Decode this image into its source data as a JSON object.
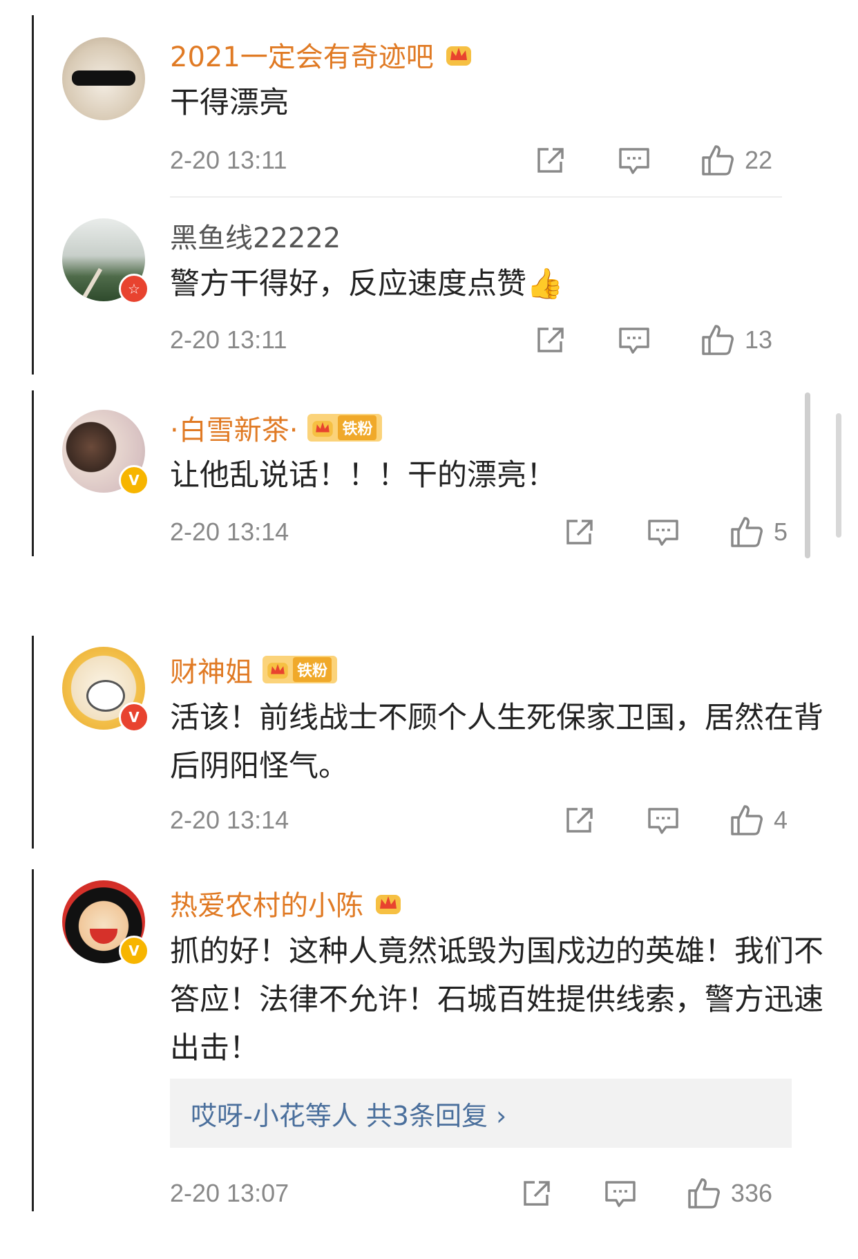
{
  "comments": [
    {
      "username": "2021一定会有奇迹吧",
      "text": "干得漂亮",
      "time": "2-20 13:11",
      "likes": "22",
      "name_color": "orange",
      "verified": "none",
      "crown": true,
      "fan_badge": null
    },
    {
      "username": "黑鱼线22222",
      "text": "警方干得好，反应速度点赞👍",
      "time": "2-20 13:11",
      "likes": "13",
      "name_color": "gray",
      "verified": "red-star",
      "crown": false,
      "fan_badge": null
    },
    {
      "username": "·白雪新茶·",
      "text": "让他乱说话！！！干的漂亮！",
      "time": "2-20 13:14",
      "likes": "5",
      "name_color": "orange",
      "verified": "gold-v",
      "crown": true,
      "fan_badge": "铁粉"
    },
    {
      "username": "财神姐",
      "text": "活该！前线战士不顾个人生死保家卫国，居然在背后阴阳怪气。",
      "time": "2-20 13:14",
      "likes": "4",
      "name_color": "orange",
      "verified": "red-v",
      "crown": true,
      "fan_badge": "铁粉"
    },
    {
      "username": "热爱农村的小陈",
      "text": "抓的好！这种人竟然诋毁为国戍边的英雄！我们不答应！法律不允许！石城百姓提供线索，警方迅速出击！",
      "time": "2-20 13:07",
      "likes": "336",
      "name_color": "orange",
      "verified": "gold-v",
      "crown": true,
      "fan_badge": null,
      "replies_summary": "哎呀-小花等人  共3条回复 ›"
    }
  ],
  "colors": {
    "orange_name": "#e07a24",
    "reply_link": "#4a6f9c",
    "meta_gray": "#888888"
  },
  "icons": [
    "share-icon",
    "comment-icon",
    "thumbs-up-icon",
    "crown-icon",
    "verified-v-icon"
  ]
}
